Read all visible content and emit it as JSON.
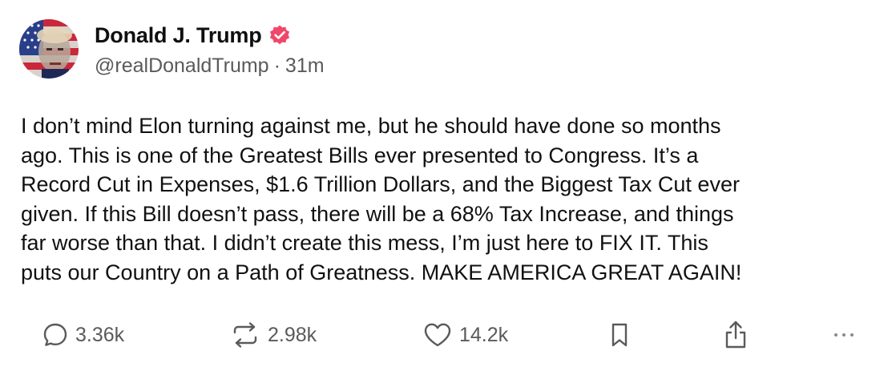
{
  "author": {
    "display_name": "Donald J. Trump",
    "handle": "@realDonaldTrump",
    "separator": "·",
    "time_ago": "31m",
    "verified_color": "#f0486b"
  },
  "post": {
    "lines": [
      "I don’t mind Elon turning against me, but he should have done so months",
      "ago. This is one of the Greatest Bills ever presented to Congress. It’s a",
      "Record Cut in Expenses, $1.6 Trillion Dollars, and the Biggest Tax Cut ever",
      "given. If this Bill doesn’t pass, there will be a 68% Tax Increase, and things",
      "far worse than that. I didn’t create this mess, I’m just here to FIX IT. This",
      "puts our Country on a Path of Greatness. MAKE AMERICA GREAT AGAIN!"
    ]
  },
  "actions": {
    "replies": "3.36k",
    "reposts": "2.98k",
    "likes": "14.2k",
    "icons": [
      "reply-icon",
      "repost-icon",
      "heart-icon",
      "bookmark-icon",
      "share-icon",
      "more-icon"
    ]
  },
  "colors": {
    "text": "#111111",
    "muted": "#5a5a5a",
    "verified": "#f0486b"
  }
}
